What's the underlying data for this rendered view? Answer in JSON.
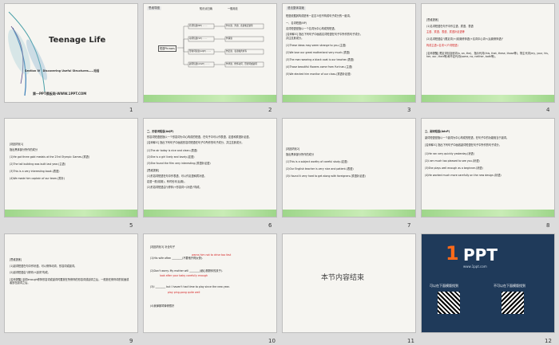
{
  "slides": [
    {
      "num": "1",
      "title": "Teenage Life",
      "section": "Section Ⅳ　Discovering Useful Structures——短语",
      "site": "第一PPT模板网-WWW.1PPT.COM"
    },
    {
      "num": "2",
      "header": "思维导图",
      "l1": "知识点归纳",
      "l2": "一般用法",
      "center": "短语Phrases",
      "boxes": [
        "名词短语(NP) ·······",
        "动词短语(VP) ·······",
        "形容词短语(AdjP) ·······",
        "副词短语(AdvP) ·······"
      ],
      "descs": [
        "作主语、宾语、表语和定语等",
        "作谓语",
        "作定语、表语和宾补等",
        "作状语、修饰动词、形容词或副词"
      ]
    },
    {
      "num": "3",
      "header": "语法整体突破",
      "lines": [
        "短语依据其构成是有一定意义但不构成句子成分的一组词。",
        "一、名词短语(NP)",
        "名词短语是指以一个名词为中心构成的短语。",
        "[名师释义] 指出下列句子中画线名词短语在句子中所作的句子成分。",
        "并注意其成分。",
        "(1)These ideas may seem strange to you.(主语)",
        "(2)We love our great motherland very much.(宾语)",
        "(3)The man wearing a black coat is our teacher.(表语)",
        "(4)Those beautiful flowers come from Yun'nan.(主语)",
        "(5)We elected him monitor of our class.(宾语补足语)"
      ]
    },
    {
      "num": "4",
      "lines": [
        "[思维提炼]",
        "(1)名词短语在句子中作主语、宾语、表语",
        "主语、宾语、表语、宾语补足语等",
        "(2)名词短语由\"(限定词)+(前置修饰语)+名词中心词+(后置修饰语)\"",
        "构成主语=名词+(介词短语)",
        "[名师提醒] 限定词包括冠词(a, an, the)、指示代词(this, that, these, those等)、物主代词(my, your, his, her, our, their等)和不定代词(some, no, neither, both等)。"
      ]
    },
    {
      "num": "5",
      "lines": [
        "[巩固内化1]",
        "指出黑体部分所作的成分",
        "(1)He got three gold medals at the 23rd Olympic Games.(宾语)",
        "(2)The tall building was built last year.(主语)",
        "(3)This is a very interesting book.(表语)",
        "(4)We made him captain of our team.(宾补)"
      ]
    },
    {
      "num": "6",
      "lines": [
        "二、形容词短语(AdjP)",
        "形容词短语是指以一个形容词为中心构成的短语，在句子中可以作表语、定语和宾语补足语。",
        "[名师释义] 指出下列句子中画线形容词短语在句子中所作的句子成分，并注意其成分。",
        "(1)The air today is nice and clean.(表语)",
        "(2)She is a girl lively and lovely.(定语)",
        "(3)She found the film very interesting.(宾语补足语)",
        "[思维提炼]",
        "(1)形容词短语在句中作表语、可以作定语和宾补语。",
        "定语一般(前置)，有时也可(后置)。",
        "(2)形容词短语由\"(修饰)+形容词+(补语)\"构成。"
      ]
    },
    {
      "num": "7",
      "lines": [
        "[巩固内化2]",
        "指出黑体部分所作的成分",
        "(1)This is a subject worthy of careful study.(定语)",
        "(2)Our English teacher is very nice and patient.(表语)",
        "(3)I found it very hard to get along with foreigners.(宾语补足语)"
      ]
    },
    {
      "num": "8",
      "lines": [
        "三、副词短语(AdvP)",
        "副词短语是指以一个副词为中心构成的短语，在句子中的功能相当于副词。",
        "[名师释义] 指出下列句子中画线副词短语在句子中所作的句子成分。",
        "(1)He ran very quickly yesterday.(状语)",
        "(2)I am much too pleased to see you.(状语)",
        "(3)She plays well enough as a beginner.(状语)",
        "(4)He worked much more carefully on the new design.(状语)"
      ]
    },
    {
      "num": "9",
      "lines": [
        "[思维提炼]",
        "(1)副词短语在句中作状语。可以修饰动词、形容词或副词。",
        "(2)副词短语由\"(修饰)+副词\"构成。",
        "[名师提醒] 副词enough修饰形容词或副词时要放在所修饰的形容词或副词之后，一般放在修饰词的前面或者放在副词之后。"
      ]
    },
    {
      "num": "10",
      "lines": [
        "[巩固内化3] 补全句子",
        "(1)His wife often ________(不要他开得太快).",
        "(2)Don't worry. My mother will ________(细心照顾你的孩子).",
        "(3)I ________ but I haven't had time to play since the new year.",
        "(4)我弹钢琴弹得很好"
      ],
      "fills": [
        "warns him not to drive too fast",
        "look after your baby carefully enough",
        "play ping-pong quite well"
      ]
    },
    {
      "num": "11",
      "end": "本节内容结束"
    },
    {
      "num": "12",
      "logo_num": "1",
      "logo_text": "PPT",
      "logo_site": "www.1ppt.com",
      "cta1": "可以在下面模版找到",
      "cta2": "不可以在下面模版找到"
    }
  ]
}
